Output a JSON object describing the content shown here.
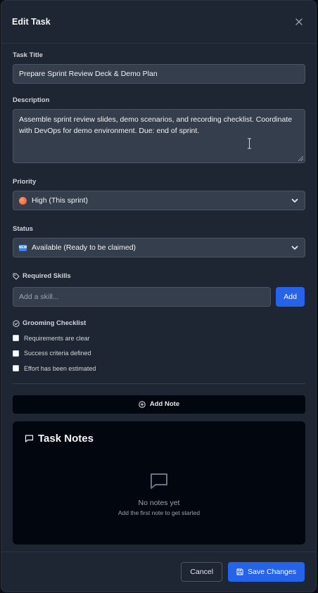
{
  "modal": {
    "title": "Edit Task",
    "close_icon": "close-icon"
  },
  "task_title": {
    "label": "Task Title",
    "value": "Prepare Sprint Review Deck & Demo Plan"
  },
  "description": {
    "label": "Description",
    "value": "Assemble sprint review slides, demo scenarios, and recording checklist. Coordinate with DevOps for demo environment. Due: end of sprint."
  },
  "priority": {
    "label": "Priority",
    "selected": "High (This sprint)",
    "icon": "orange-circle",
    "color": "#f46a3a"
  },
  "status": {
    "label": "Status",
    "selected": "Available (Ready to be claimed)",
    "icon": "new-badge"
  },
  "skills": {
    "label": "Required Skills",
    "placeholder": "Add a skill...",
    "add_label": "Add"
  },
  "checklist": {
    "label": "Grooming Checklist",
    "items": [
      {
        "label": "Requirements are clear",
        "checked": false
      },
      {
        "label": "Success criteria defined",
        "checked": false
      },
      {
        "label": "Effort has been estimated",
        "checked": false
      }
    ]
  },
  "notes": {
    "add_label": "Add Note",
    "title": "Task Notes",
    "empty_title": "No notes yet",
    "empty_subtitle": "Add the first note to get started"
  },
  "footer": {
    "cancel_label": "Cancel",
    "save_label": "Save Changes"
  },
  "colors": {
    "accent": "#2563eb",
    "modal_bg": "#1f2633",
    "panel_bg": "#02060f"
  }
}
